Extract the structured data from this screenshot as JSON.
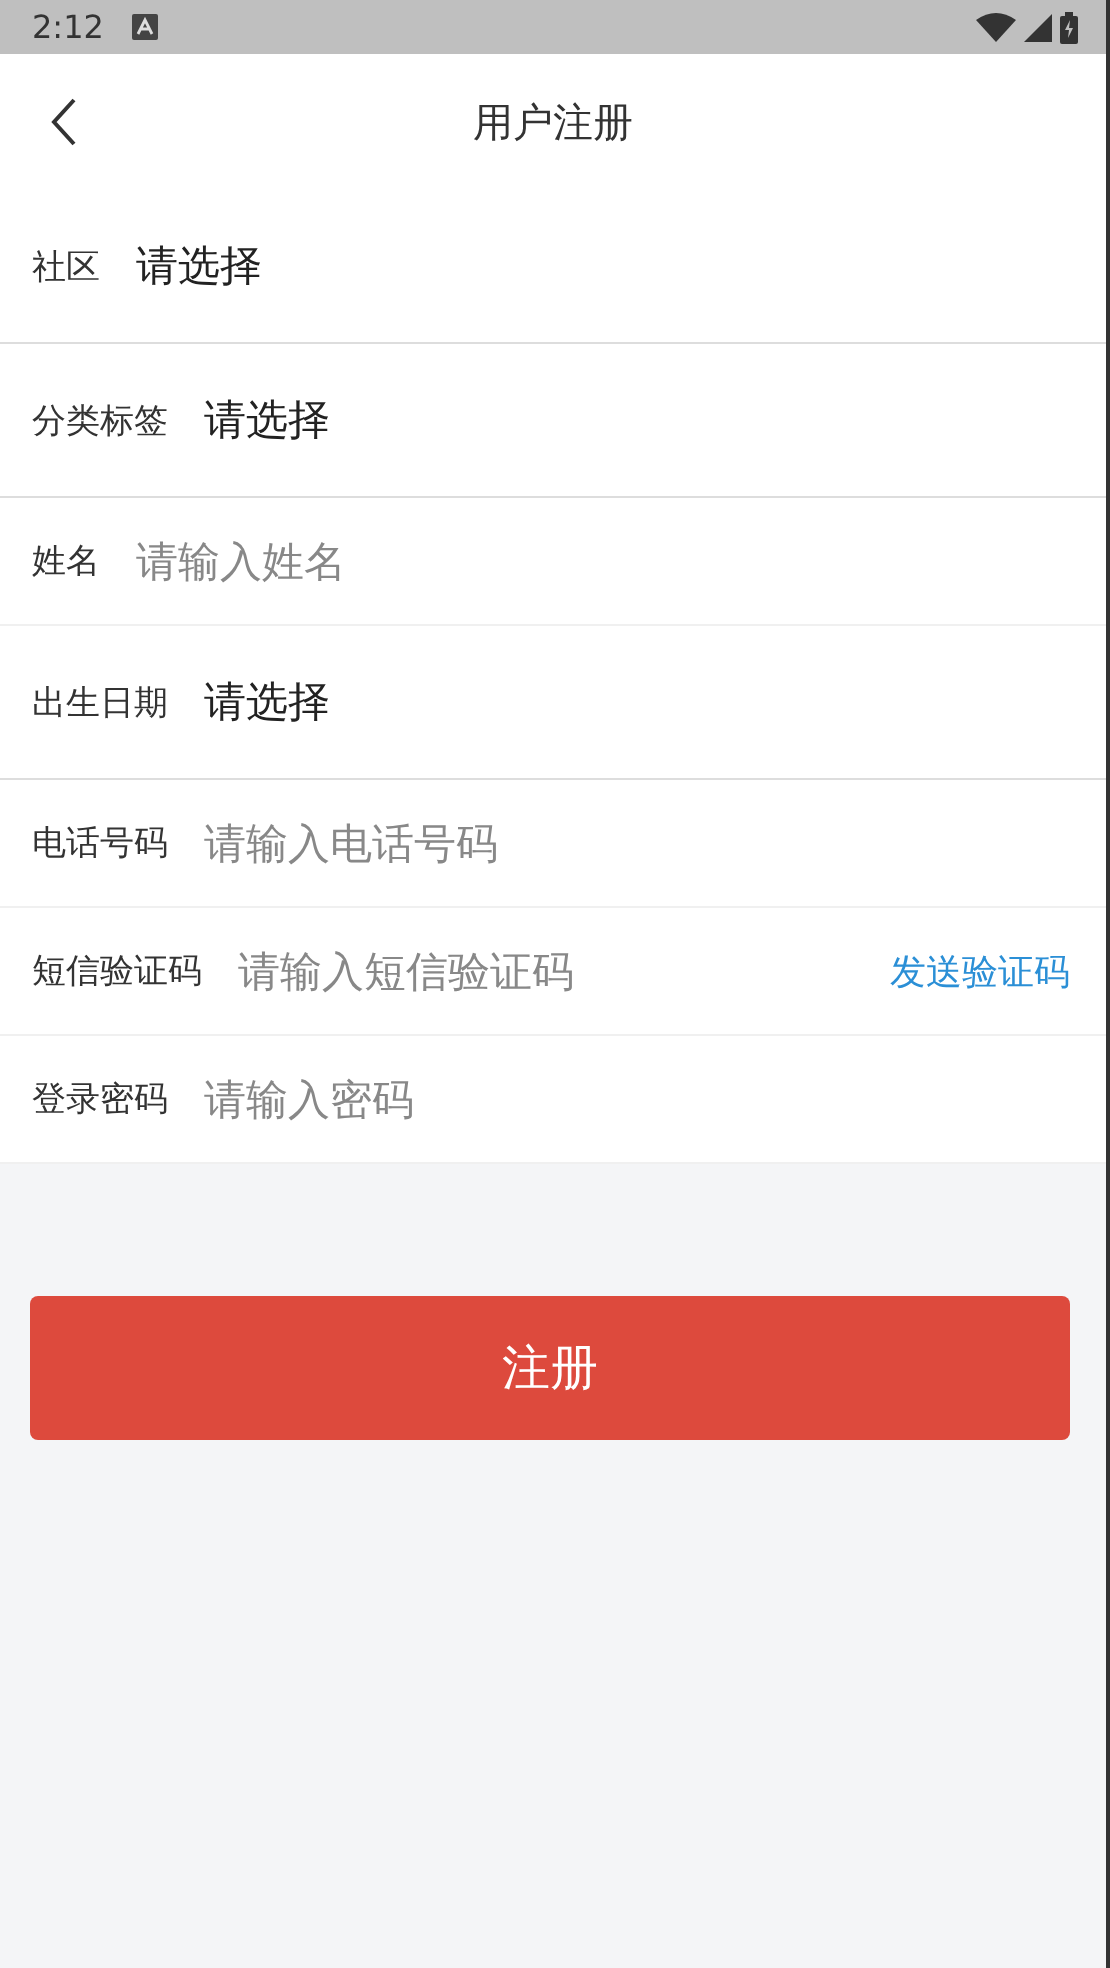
{
  "status_bar": {
    "time": "2:12"
  },
  "header": {
    "title": "用户注册"
  },
  "form": {
    "rows": [
      {
        "kind": "select",
        "label": "社区",
        "value": "请选择"
      },
      {
        "kind": "select",
        "label": "分类标签",
        "value": "请选择"
      },
      {
        "kind": "input",
        "label": "姓名",
        "placeholder": "请输入姓名"
      },
      {
        "kind": "select",
        "label": "出生日期",
        "value": "请选择"
      },
      {
        "kind": "input",
        "label": "电话号码",
        "placeholder": "请输入电话号码"
      },
      {
        "kind": "input",
        "label": "短信验证码",
        "placeholder": "请输入短信验证码",
        "action": "发送验证码"
      },
      {
        "kind": "input",
        "label": "登录密码",
        "placeholder": "请输入密码"
      }
    ]
  },
  "submit_button": {
    "label": "注册"
  }
}
